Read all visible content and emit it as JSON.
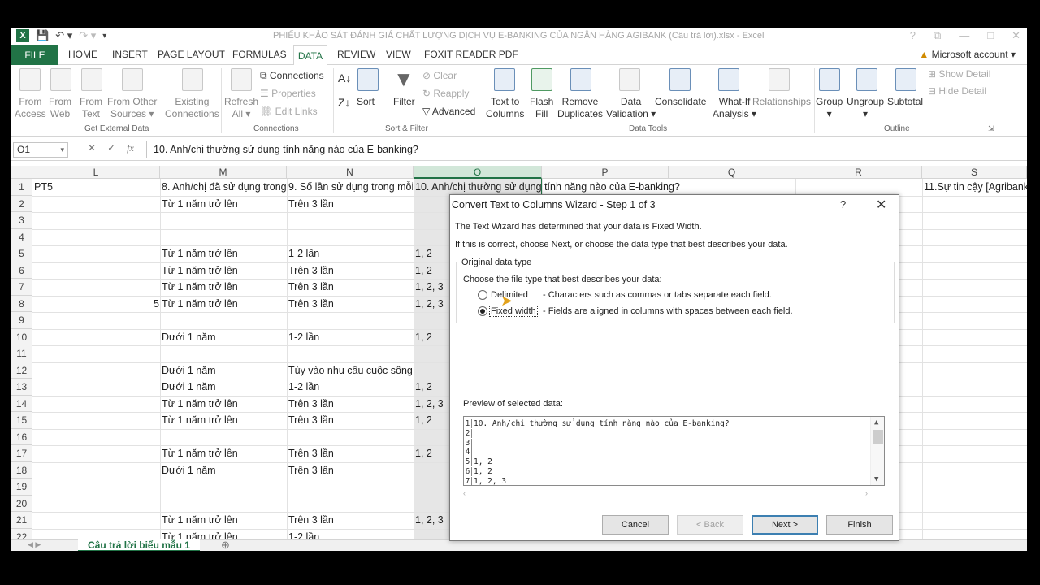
{
  "window": {
    "title": "PHIẾU KHẢO SÁT ĐÁNH GIÁ CHẤT LƯỢNG DỊCH VỤ E-BANKING CỦA NGÂN HÀNG AGIBANK (Câu trả lời).xlsx - Excel",
    "controls": [
      "?",
      "⧉",
      "—",
      "□",
      "✕"
    ]
  },
  "tabs": {
    "file": "FILE",
    "items": [
      "HOME",
      "INSERT",
      "PAGE LAYOUT",
      "FORMULAS",
      "DATA",
      "REVIEW",
      "VIEW",
      "FOXIT READER PDF"
    ],
    "active": "DATA",
    "account": "Microsoft account"
  },
  "ribbon": {
    "get_external": {
      "from_access": [
        "From",
        "Access"
      ],
      "from_web": [
        "From",
        "Web"
      ],
      "from_text": [
        "From",
        "Text"
      ],
      "from_other": [
        "From Other",
        "Sources ▾"
      ],
      "existing": [
        "Existing",
        "Connections"
      ],
      "group": "Get External Data"
    },
    "connections": {
      "refresh": [
        "Refresh",
        "All ▾"
      ],
      "connections": "Connections",
      "properties": "Properties",
      "edit_links": "Edit Links",
      "group": "Connections"
    },
    "sort_filter": {
      "sort": "Sort",
      "filter": "Filter",
      "clear": "Clear",
      "reapply": "Reapply",
      "advanced": "Advanced",
      "group": "Sort & Filter"
    },
    "data_tools": {
      "text_to_columns": [
        "Text to",
        "Columns"
      ],
      "flash_fill": [
        "Flash",
        "Fill"
      ],
      "remove_dup": [
        "Remove",
        "Duplicates"
      ],
      "validation": [
        "Data",
        "Validation ▾"
      ],
      "consolidate": "Consolidate",
      "whatif": [
        "What-If",
        "Analysis ▾"
      ],
      "relationships": "Relationships",
      "group": "Data Tools"
    },
    "outline": {
      "group_btn": "Group",
      "ungroup": "Ungroup",
      "subtotal": "Subtotal",
      "show_detail": "Show Detail",
      "hide_detail": "Hide Detail",
      "group": "Outline"
    }
  },
  "formula_bar": {
    "name_box": "O1",
    "fx": "fx",
    "content": "10. Anh/chị thường sử dụng tính năng nào của E-banking?"
  },
  "columns": [
    "L",
    "M",
    "N",
    "O",
    "P",
    "Q",
    "R",
    "S"
  ],
  "rows": [
    {
      "n": "1",
      "L": "PT5",
      "M": "8.  Anh/chị đã sử dụng trong",
      "N": "9. Số lần sử dụng trong mỗi",
      "O": "10. Anh/chị thường sử dụng tính năng nào của E-banking?",
      "S": "11.Sự tin cậy [Agribank"
    },
    {
      "n": "2",
      "M": "Từ 1 năm trở lên",
      "N": "Trên 3 lần"
    },
    {
      "n": "3"
    },
    {
      "n": "4"
    },
    {
      "n": "5",
      "M": "Từ 1 năm trở lên",
      "N": "1-2 lần",
      "O": "1, 2"
    },
    {
      "n": "6",
      "M": "Từ 1 năm trở lên",
      "N": "Trên 3 lần",
      "O": "1, 2"
    },
    {
      "n": "7",
      "M": "Từ 1 năm trở lên",
      "N": "Trên 3 lần",
      "O": "1, 2, 3"
    },
    {
      "n": "8",
      "L": "5",
      "M": "Từ 1 năm trở lên",
      "N": "Trên 3 lần",
      "O": "1, 2, 3"
    },
    {
      "n": "9"
    },
    {
      "n": "10",
      "M": "Dưới 1 năm",
      "N": "1-2 lần",
      "O": "1, 2"
    },
    {
      "n": "11"
    },
    {
      "n": "12",
      "M": "Dưới 1 năm",
      "N": "Tùy vào nhu cầu cuộc sống"
    },
    {
      "n": "13",
      "M": "Dưới 1 năm",
      "N": "1-2 lần",
      "O": "1, 2"
    },
    {
      "n": "14",
      "M": "Từ 1 năm trở lên",
      "N": "Trên 3 lần",
      "O": "1, 2, 3"
    },
    {
      "n": "15",
      "M": "Từ 1 năm trở lên",
      "N": "Trên 3 lần",
      "O": "1, 2"
    },
    {
      "n": "16"
    },
    {
      "n": "17",
      "M": "Từ 1 năm trở lên",
      "N": "Trên 3 lần",
      "O": "1, 2"
    },
    {
      "n": "18",
      "M": "Dưới 1 năm",
      "N": "Trên 3 lần"
    },
    {
      "n": "19"
    },
    {
      "n": "20"
    },
    {
      "n": "21",
      "M": "Từ 1 năm trở lên",
      "N": "Trên 3 lần",
      "O": "1, 2, 3"
    },
    {
      "n": "22",
      "M": "Từ 1 năm trở lên",
      "N": "1-2 lần"
    }
  ],
  "sheet_tab": "Câu trả lời biểu mẫu 1",
  "dialog": {
    "title": "Convert Text to Columns Wizard - Step 1 of 3",
    "help": "?",
    "close": "✕",
    "intro1": "The Text Wizard has determined that your data is Fixed Width.",
    "intro2": "If this is correct, choose Next, or choose the data type that best describes your data.",
    "group_label": "Original data type",
    "choose_label": "Choose the file type that best describes your data:",
    "opt_delimited": "Delimited",
    "opt_delimited_desc": "- Characters such as commas or tabs separate each field.",
    "opt_fixed": "Fixed width",
    "opt_fixed_desc": "- Fields are aligned in columns with spaces between each field.",
    "preview_label": "Preview of selected data:",
    "preview": [
      {
        "n": "1",
        "t": "10. Anh/chị thường sử dụng tính năng nào của E-banking?"
      },
      {
        "n": "2",
        "t": ""
      },
      {
        "n": "3",
        "t": ""
      },
      {
        "n": "4",
        "t": ""
      },
      {
        "n": "5",
        "t": "1, 2"
      },
      {
        "n": "6",
        "t": "1, 2"
      },
      {
        "n": "7",
        "t": "1, 2, 3"
      }
    ],
    "cancel": "Cancel",
    "back": "< Back",
    "next": "Next >",
    "finish": "Finish"
  },
  "colors": {
    "excel_green": "#217346",
    "selection": "#e6e6e6"
  }
}
